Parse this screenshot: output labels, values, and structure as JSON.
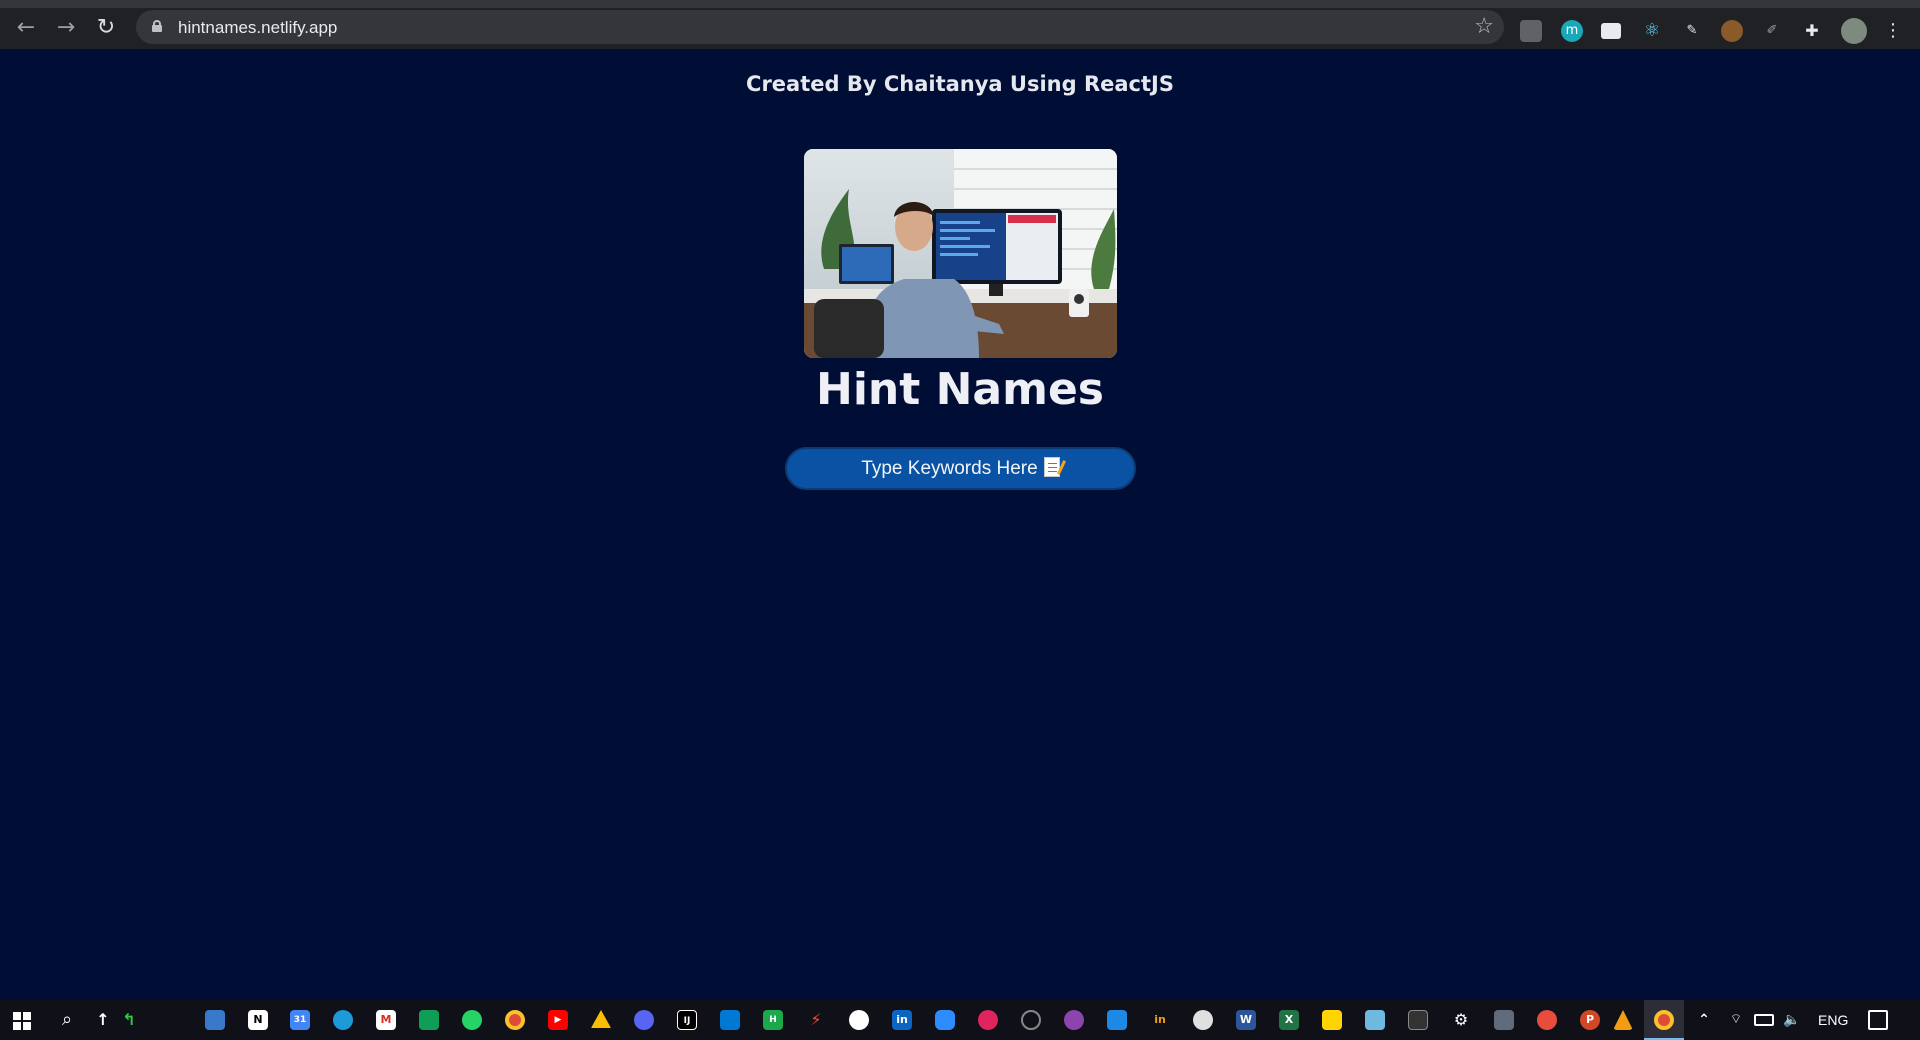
{
  "browser": {
    "url": "hintnames.netlify.app",
    "back_glyph": "←",
    "forward_glyph": "→",
    "reload_glyph": "↻",
    "star_glyph": "☆",
    "menu_glyph": "⋮",
    "extensions": [
      "camera-icon",
      "m-extension-icon",
      "screen-icon",
      "react-devtools-icon",
      "pen-extension-icon",
      "cookie-icon",
      "pencil-icon",
      "puzzle-icon",
      "profile-avatar"
    ]
  },
  "page": {
    "credit": "Created By Chaitanya Using ReactJS",
    "title": "Hint Names",
    "search_label": "Type Keywords Here",
    "colors": {
      "background": "#000d35",
      "button": "#0a52a3"
    }
  },
  "taskbar": {
    "language": "ENG",
    "apps": [
      "notion",
      "calendar",
      "edge",
      "gmail",
      "sheets",
      "whatsapp",
      "chrome",
      "youtube",
      "drive",
      "discord",
      "intellij",
      "vscode",
      "hackerrank",
      "git",
      "github",
      "linkedin",
      "zoom",
      "recorder",
      "chrome-dev",
      "github-desktop",
      "calendar-app",
      "in-app",
      "clock",
      "word",
      "excel",
      "sticky-notes",
      "notepad",
      "terminal",
      "settings",
      "calculator",
      "paint",
      "powerpoint",
      "vlc",
      "chrome-active"
    ]
  }
}
